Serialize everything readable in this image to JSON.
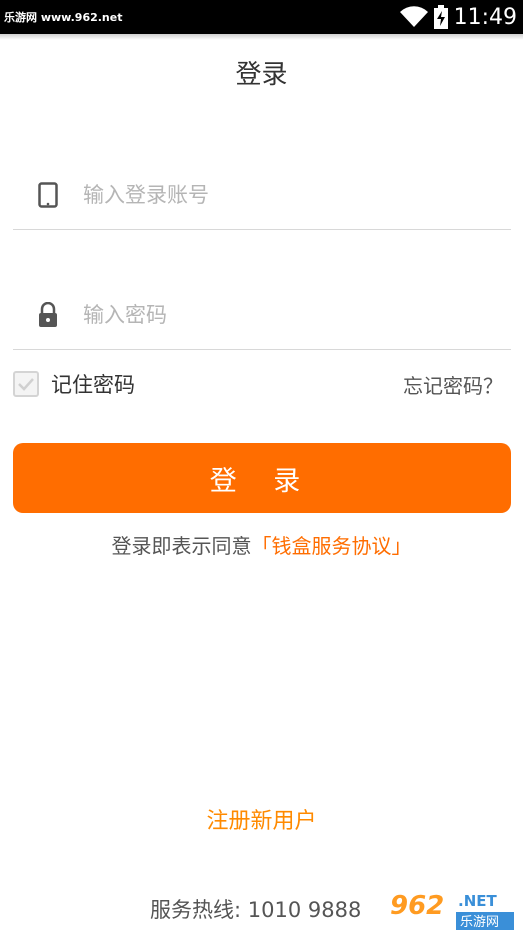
{
  "status_bar": {
    "watermark": "乐游网 www.962.net",
    "time": "11:49"
  },
  "page": {
    "title": "登录"
  },
  "form": {
    "account_placeholder": "输入登录账号",
    "password_placeholder": "输入密码",
    "remember_label": "记住密码",
    "forgot_label": "忘记密码？",
    "login_button": "登 录"
  },
  "agreement": {
    "prefix": "登录即表示同意",
    "link": "「钱盒服务协议」"
  },
  "footer": {
    "register": "注册新用户",
    "hotline": "服务热线: 1010 9888"
  },
  "watermark_logo": {
    "number": "962",
    "suffix": ".NET",
    "name": "乐游网"
  },
  "colors": {
    "accent": "#ff6d00",
    "register": "#ff8a00",
    "status_bar": "#000000"
  }
}
